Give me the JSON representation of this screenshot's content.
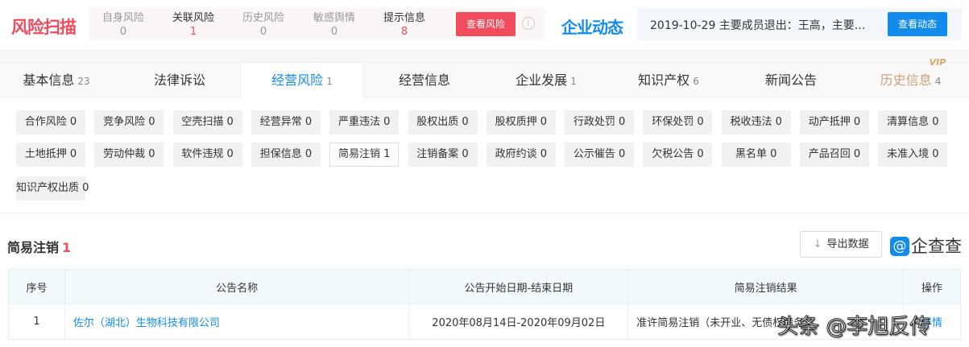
{
  "risk_scan": {
    "logo": "风险扫描",
    "items": [
      {
        "label": "自身风险",
        "count": "0"
      },
      {
        "label": "关联风险",
        "count": "1"
      },
      {
        "label": "历史风险",
        "count": "0"
      },
      {
        "label": "敏感舆情",
        "count": "0"
      },
      {
        "label": "提示信息",
        "count": "8"
      }
    ],
    "button": "查看风险",
    "info_icon": "i"
  },
  "dynamics": {
    "logo": "企业动态",
    "text": "2019-10-29 主要成员退出：王高，主要...",
    "button": "查看动态"
  },
  "tabs": [
    {
      "label": "基本信息",
      "count": "23"
    },
    {
      "label": "法律诉讼",
      "count": ""
    },
    {
      "label": "经营风险",
      "count": "1"
    },
    {
      "label": "经营信息",
      "count": ""
    },
    {
      "label": "企业发展",
      "count": "1"
    },
    {
      "label": "知识产权",
      "count": "6"
    },
    {
      "label": "新闻公告",
      "count": ""
    },
    {
      "label": "历史信息",
      "count": "4",
      "badge": "VIP"
    }
  ],
  "tags": [
    "合作风险 0",
    "竞争风险 0",
    "空壳扫描 0",
    "经营异常 0",
    "严重违法 0",
    "股权出质 0",
    "股权质押 0",
    "行政处罚 0",
    "环保处罚 0",
    "税收违法 0",
    "动产抵押 0",
    "清算信息 0",
    "土地抵押 0",
    "劳动仲裁 0",
    "软件违规 0",
    "担保信息 0",
    "简易注销 1",
    "注销备案 0",
    "政府约谈 0",
    "公示催告 0",
    "欠税公告 0",
    "黑名单 0",
    "产品召回 0",
    "未准入境 0",
    "知识产权出质 0"
  ],
  "section": {
    "title": "简易注销",
    "count": "1",
    "export": "导出数据",
    "export_icon": "↓",
    "brand": "企查查",
    "brand_icon": "@"
  },
  "table": {
    "headers": [
      "序号",
      "公告名称",
      "公告开始日期-结束日期",
      "简易注销结果",
      "操作"
    ],
    "rows": [
      {
        "no": "1",
        "name": "佐尔（湖北）生物科技有限公司",
        "date": "2020年08月14日-2020年09月02日",
        "result": "准许简易注销（未开业、无债权债务）",
        "action": "详情"
      }
    ]
  },
  "watermark": "头条 @李旭反传"
}
